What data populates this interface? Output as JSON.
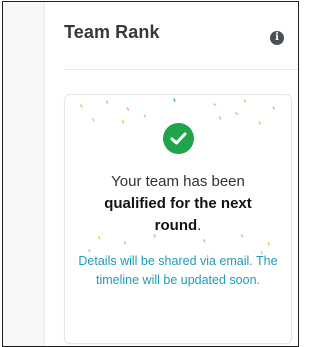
{
  "panel": {
    "title": "Team Rank"
  },
  "icons": {
    "info": "info-circle-icon",
    "success": "check-circle-icon"
  },
  "status": {
    "line1": "Your team has been",
    "line2": "qualified for the next",
    "line3_bold": "round",
    "line3_tail": ".",
    "note": "Details will be shared via email. The timeline will be updated soon."
  },
  "colors": {
    "success": "#1fa34b",
    "note": "#1f9bb8",
    "title": "#333a40"
  }
}
